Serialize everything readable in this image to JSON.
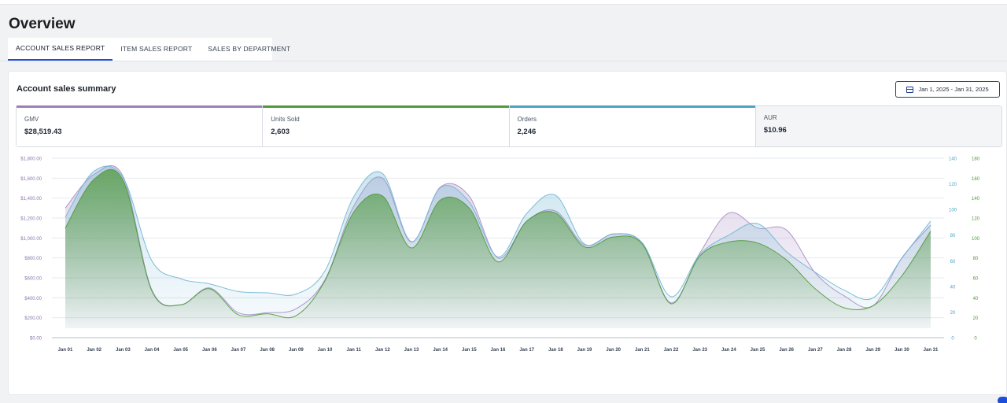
{
  "page": {
    "title": "Overview"
  },
  "tabs": [
    {
      "label": "ACCOUNT SALES REPORT",
      "active": true
    },
    {
      "label": "ITEM SALES REPORT",
      "active": false
    },
    {
      "label": "SALES BY DEPARTMENT",
      "active": false
    }
  ],
  "card": {
    "title": "Account sales summary",
    "date_range": "Jan 1, 2025 - Jan 31, 2025",
    "date_icon": "calendar-icon"
  },
  "metrics": [
    {
      "label": "GMV",
      "value": "$28,519.43",
      "color": "#9b80b8"
    },
    {
      "label": "Units Sold",
      "value": "2,603",
      "color": "#4f9a3c"
    },
    {
      "label": "Orders",
      "value": "2,246",
      "color": "#4aa3c4"
    },
    {
      "label": "AUR",
      "value": "$10.96",
      "color": ""
    }
  ],
  "chart_data": {
    "type": "area",
    "x": [
      "Jan 01",
      "Jan 02",
      "Jan 03",
      "Jan 04",
      "Jan 05",
      "Jan 06",
      "Jan 07",
      "Jan 08",
      "Jan 09",
      "Jan 10",
      "Jan 11",
      "Jan 12",
      "Jan 13",
      "Jan 14",
      "Jan 15",
      "Jan 16",
      "Jan 17",
      "Jan 18",
      "Jan 19",
      "Jan 20",
      "Jan 21",
      "Jan 22",
      "Jan 23",
      "Jan 24",
      "Jan 25",
      "Jan 26",
      "Jan 27",
      "Jan 28",
      "Jan 29",
      "Jan 30",
      "Jan 31"
    ],
    "axes": {
      "left": {
        "ticks": [
          "$0.00",
          "$200.00",
          "$400.00",
          "$600.00",
          "$800.00",
          "$1,000.00",
          "$1,200.00",
          "$1,400.00",
          "$1,600.00",
          "$1,800.00"
        ],
        "range": [
          0,
          1800
        ],
        "color": "#8b77aa"
      },
      "right_orders": {
        "ticks": [
          "0",
          "20",
          "40",
          "60",
          "80",
          "100",
          "120",
          "140"
        ],
        "range": [
          0,
          140
        ],
        "color": "#4aa3c4"
      },
      "right_units": {
        "ticks": [
          "0",
          "20",
          "40",
          "60",
          "80",
          "100",
          "120",
          "140",
          "160",
          "180"
        ],
        "range": [
          0,
          180
        ],
        "color": "#4f9a3c"
      }
    },
    "grid": true,
    "series": [
      {
        "name": "GMV",
        "axis": "left",
        "color": "#a88cc4",
        "values": [
          1300,
          1640,
          1620,
          480,
          330,
          500,
          250,
          250,
          290,
          580,
          1320,
          1600,
          960,
          1510,
          1420,
          800,
          1170,
          1270,
          930,
          1040,
          950,
          350,
          850,
          1250,
          1100,
          1080,
          650,
          420,
          320,
          800,
          1130
        ]
      },
      {
        "name": "Orders",
        "axis": "right_orders",
        "color": "#6fb6d3",
        "values": [
          94,
          130,
          125,
          60,
          46,
          42,
          36,
          35,
          34,
          52,
          110,
          128,
          75,
          117,
          106,
          63,
          97,
          111,
          73,
          81,
          74,
          32,
          65,
          80,
          89,
          67,
          51,
          37,
          31,
          62,
          91
        ]
      },
      {
        "name": "Units Sold",
        "axis": "right_units",
        "color": "#4f9a3c",
        "values": [
          110,
          159,
          158,
          47,
          33,
          49,
          23,
          24,
          22,
          57,
          126,
          142,
          90,
          138,
          130,
          76,
          117,
          125,
          91,
          101,
          94,
          34,
          82,
          96,
          95,
          78,
          49,
          30,
          32,
          62,
          107
        ]
      }
    ]
  }
}
